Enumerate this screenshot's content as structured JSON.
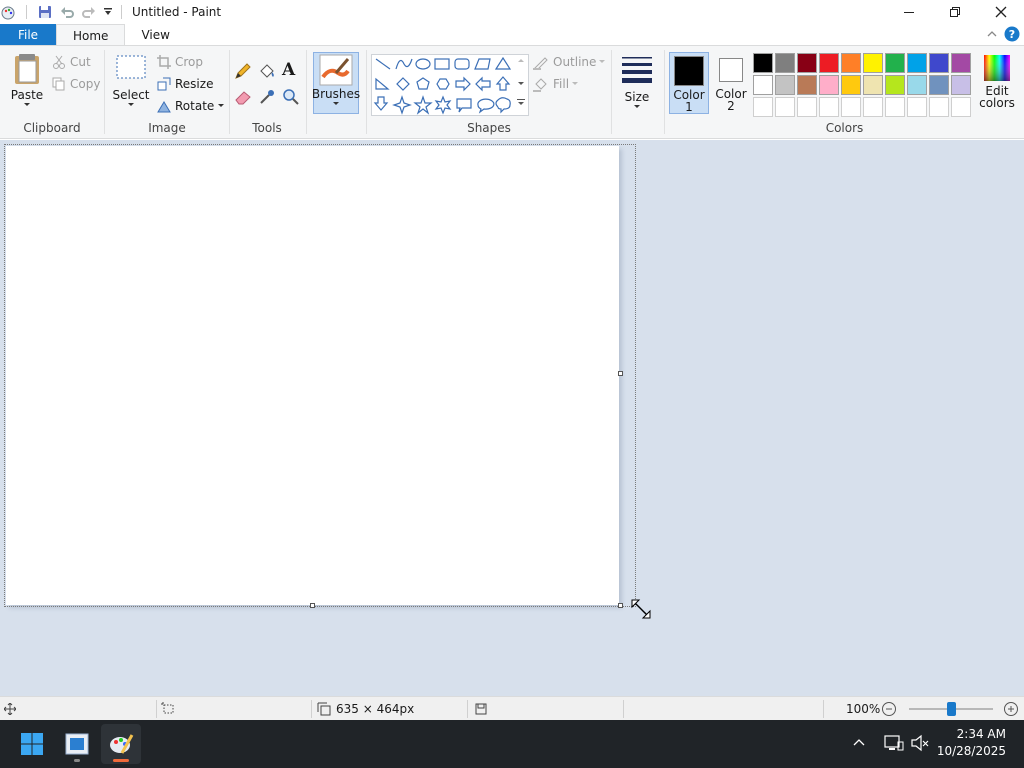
{
  "window": {
    "title": "Untitled - Paint"
  },
  "tabs": {
    "file": "File",
    "home": "Home",
    "view": "View"
  },
  "clipboard": {
    "paste": "Paste",
    "cut": "Cut",
    "copy": "Copy",
    "label": "Clipboard"
  },
  "image": {
    "select": "Select",
    "crop": "Crop",
    "resize": "Resize",
    "rotate": "Rotate",
    "label": "Image"
  },
  "tools": {
    "label": "Tools",
    "text_glyph": "A"
  },
  "brushes": {
    "label": "Brushes"
  },
  "shapes": {
    "outline": "Outline",
    "fill": "Fill",
    "label": "Shapes"
  },
  "size": {
    "label": "Size"
  },
  "colors": {
    "color1_label": "Color",
    "color1_num": "1",
    "color2_label": "Color",
    "color2_num": "2",
    "color1_value": "#000000",
    "color2_value": "#ffffff",
    "edit_label_1": "Edit",
    "edit_label_2": "colors",
    "label": "Colors",
    "palette_row1": [
      "#000000",
      "#7f7f7f",
      "#880015",
      "#ed1c24",
      "#ff7f27",
      "#fff200",
      "#22b14c",
      "#00a2e8",
      "#3f48cc",
      "#a349a4"
    ],
    "palette_row2": [
      "#ffffff",
      "#c3c3c3",
      "#b97a57",
      "#ffaec9",
      "#ffc90e",
      "#efe4b0",
      "#b5e61d",
      "#99d9ea",
      "#7092be",
      "#c8bfe7"
    ],
    "palette_row3": [
      "#ffffff",
      "#ffffff",
      "#ffffff",
      "#ffffff",
      "#ffffff",
      "#ffffff",
      "#ffffff",
      "#ffffff",
      "#ffffff",
      "#ffffff"
    ]
  },
  "status": {
    "dimensions": "635 × 464px",
    "zoom": "100%",
    "zoom_value": 100
  },
  "taskbar": {
    "time": "2:34 AM",
    "date": "10/28/2025"
  },
  "accent": "#1979ca"
}
